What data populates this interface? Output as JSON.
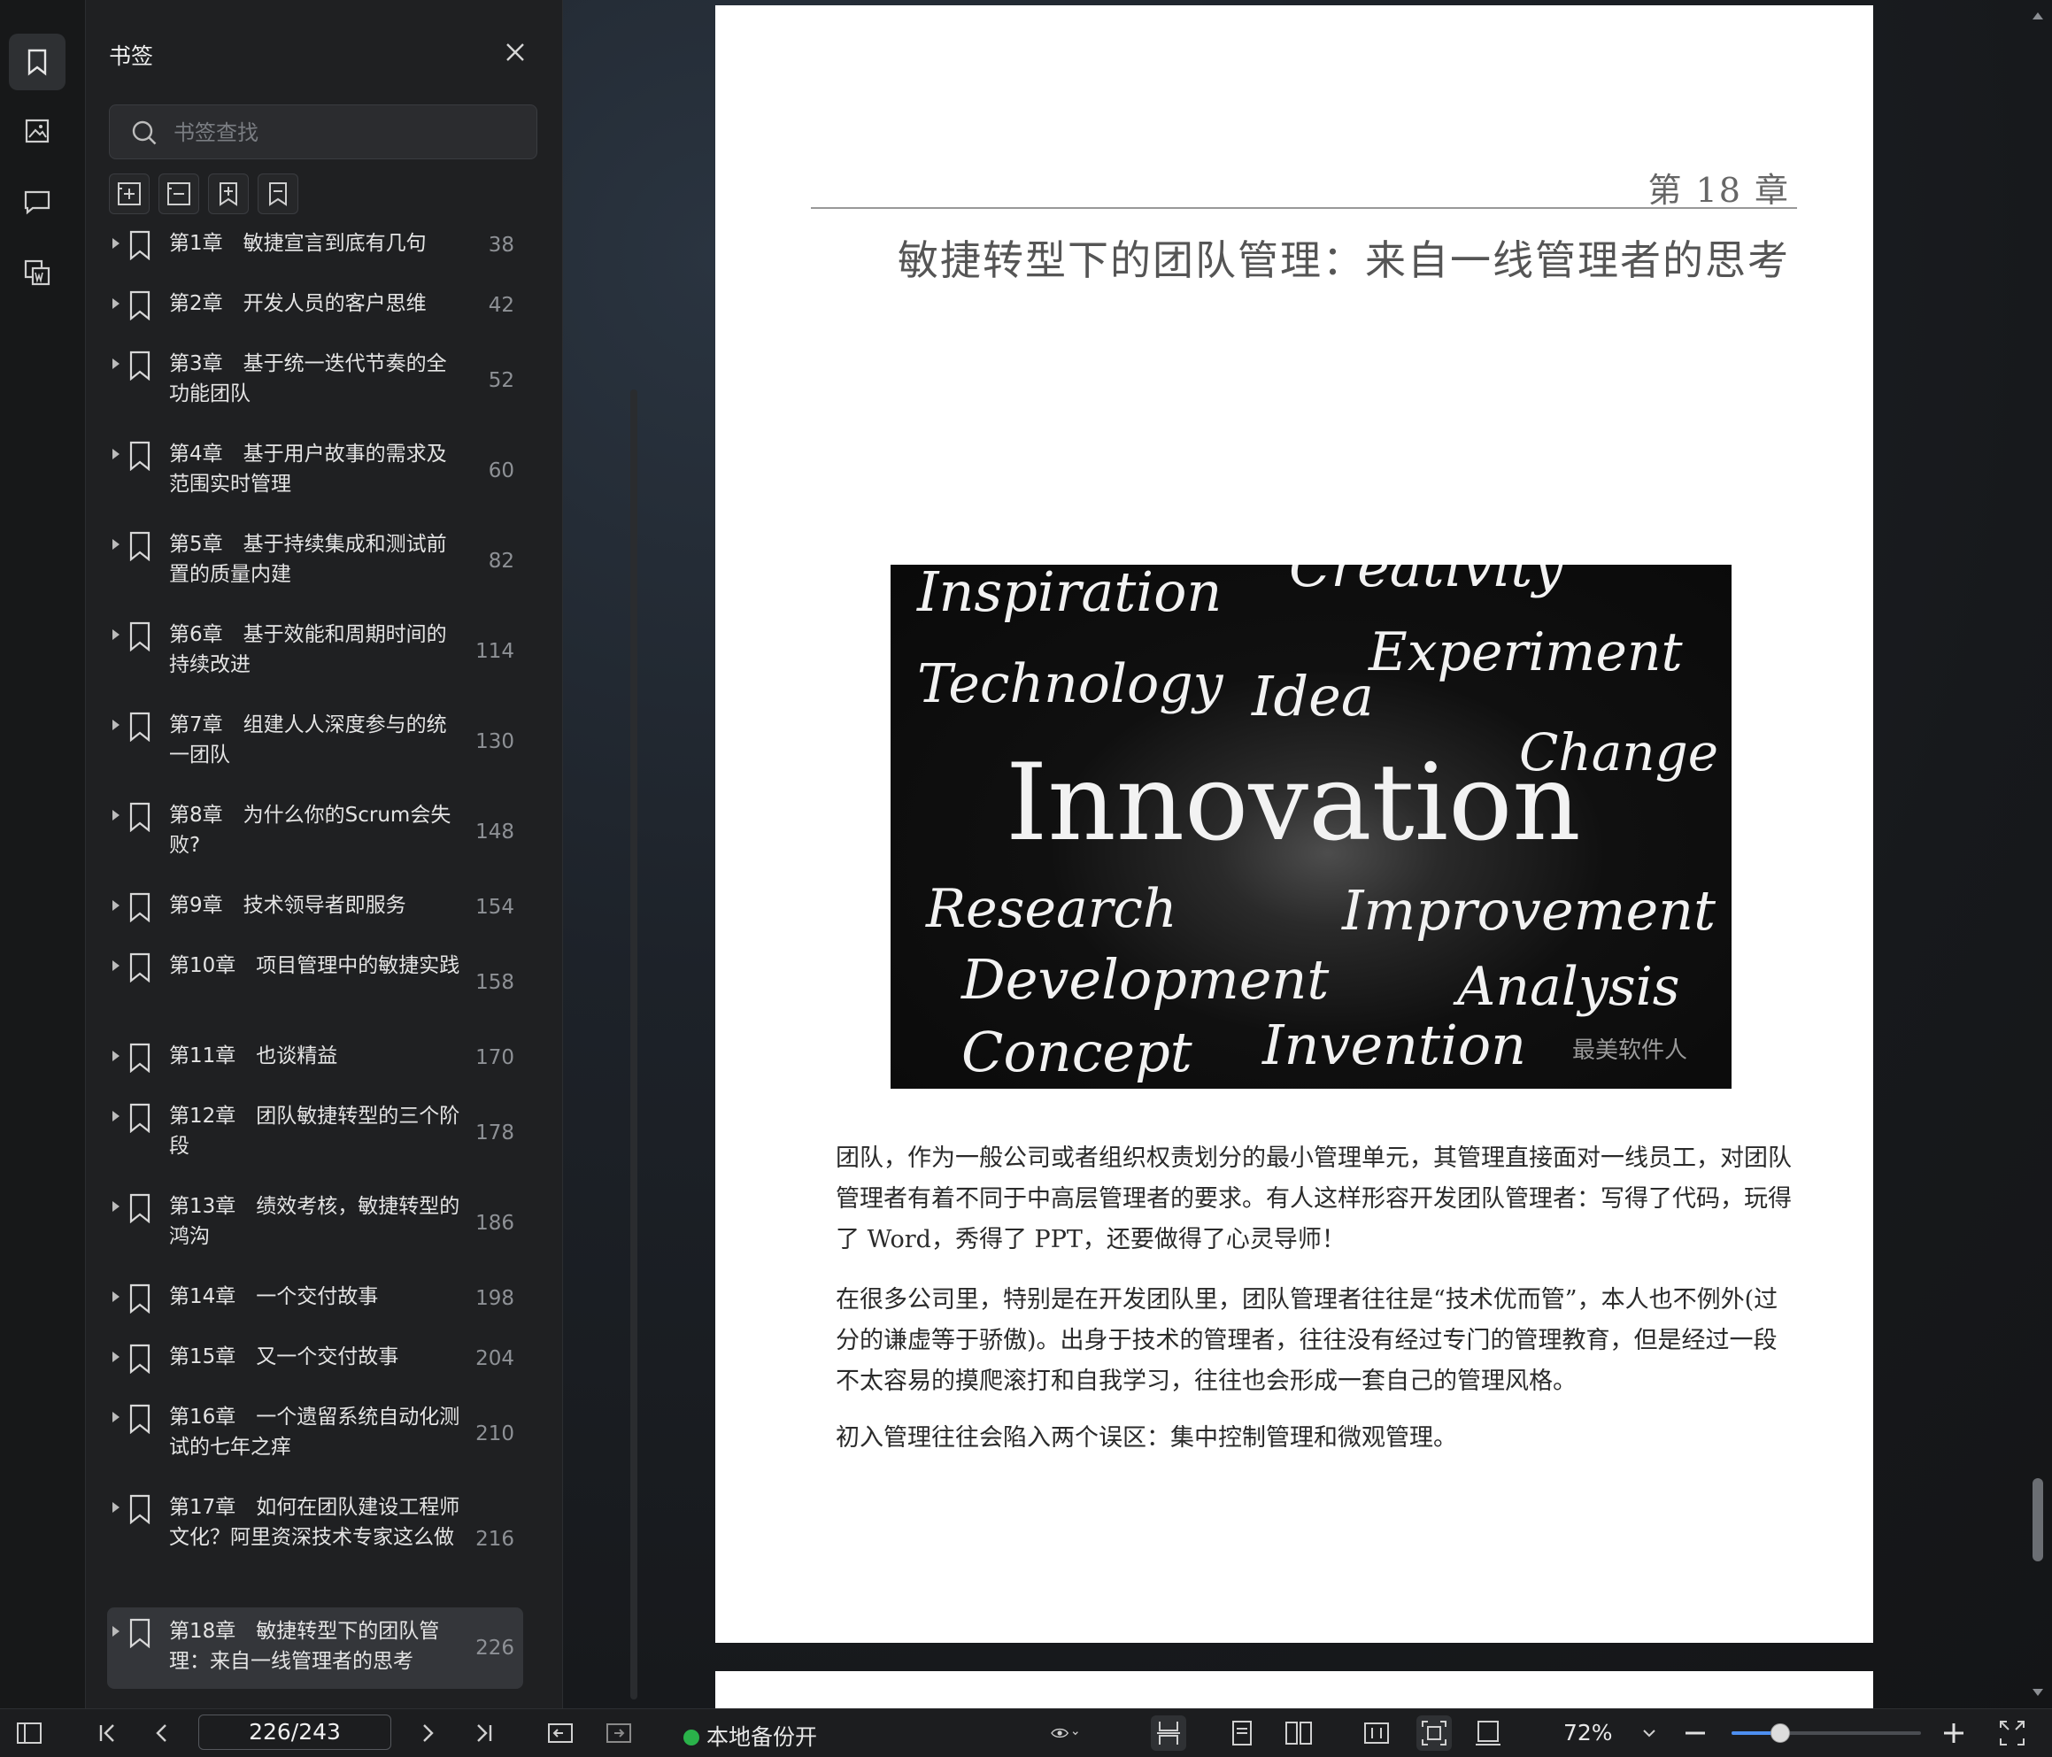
{
  "sidebar": {
    "title": "书签",
    "search_placeholder": "书签查找",
    "items": [
      {
        "label": "第1章　敏捷宣言到底有几句",
        "page": "38"
      },
      {
        "label": "第2章　开发人员的客户思维",
        "page": "42"
      },
      {
        "label": "第3章　基于统一迭代节奏的全功能团队",
        "page": "52"
      },
      {
        "label": "第4章　基于用户故事的需求及范围实时管理",
        "page": "60"
      },
      {
        "label": "第5章　基于持续集成和测试前置的质量内建",
        "page": "82"
      },
      {
        "label": "第6章　基于效能和周期时间的持续改进",
        "page": "114"
      },
      {
        "label": "第7章　组建人人深度参与的统一团队",
        "page": "130"
      },
      {
        "label": "第8章　为什么你的Scrum会失败?",
        "page": "148"
      },
      {
        "label": "第9章　技术领导者即服务",
        "page": "154"
      },
      {
        "label": "第10章　项目管理中的敏捷实践",
        "page": "158"
      },
      {
        "label": "第11章　也谈精益",
        "page": "170"
      },
      {
        "label": "第12章　团队敏捷转型的三个阶段",
        "page": "178"
      },
      {
        "label": "第13章　绩效考核，敏捷转型的鸿沟",
        "page": "186"
      },
      {
        "label": "第14章　一个交付故事",
        "page": "198"
      },
      {
        "label": "第15章　又一个交付故事",
        "page": "204"
      },
      {
        "label": "第16章　一个遗留系统自动化测试的七年之痒",
        "page": "210"
      },
      {
        "label": "第17章　如何在团队建设工程师文化？阿里资深技术专家这么做",
        "page": "216"
      },
      {
        "label": "第18章　敏捷转型下的团队管理：来自一线管理者的思考",
        "page": "226"
      }
    ]
  },
  "document": {
    "chapter_number": "第 18 章",
    "chapter_title": "敏捷转型下的团队管理：来自一线管理者的思考",
    "image_words": [
      "Inspiration",
      "Creativity",
      "Experiment",
      "Technology",
      "Idea",
      "Change",
      "Innovation",
      "Research",
      "Improvement",
      "Development",
      "Analysis",
      "Concept",
      "Invention"
    ],
    "image_watermark": "最美软件人",
    "paragraphs": [
      "团队，作为一般公司或者组织权责划分的最小管理单元，其管理直接面对一线员工，对团队管理者有着不同于中高层管理者的要求。有人这样形容开发团队管理者：写得了代码，玩得了 Word，秀得了 PPT，还要做得了心灵导师！",
      "在很多公司里，特别是在开发团队里，团队管理者往往是“技术优而管”，本人也不例外(过分的谦虚等于骄傲)。出身于技术的管理者，往往没有经过专门的管理教育，但是经过一段不太容易的摸爬滚打和自我学习，往往也会形成一套自己的管理风格。",
      "初入管理往往会陷入两个误区：集中控制管理和微观管理。"
    ]
  },
  "toolbar": {
    "page_indicator": "226/243",
    "backup_label": "本地备份开",
    "backup_color": "#2ab24a",
    "zoom": "72%",
    "zoom_slider_fraction": 0.25
  },
  "colors": {
    "accent": "#4d8ff0",
    "selected_row": "#34363a"
  }
}
